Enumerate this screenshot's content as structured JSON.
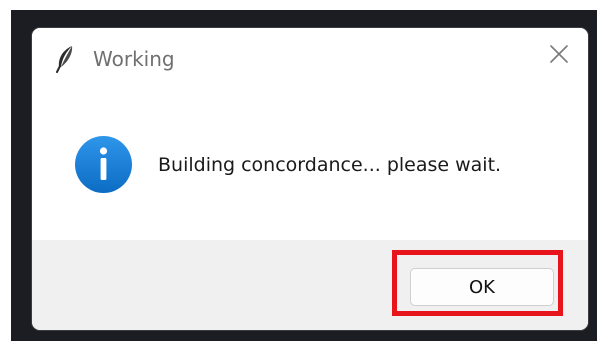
{
  "dialog": {
    "title": "Working",
    "title_icon": "feather-icon",
    "close_icon": "close-icon",
    "message": "Building concordance... please wait.",
    "message_icon": "info-icon",
    "ok_label": "OK",
    "highlight_color": "#e8141c",
    "info_color": "#1a7fd8"
  }
}
